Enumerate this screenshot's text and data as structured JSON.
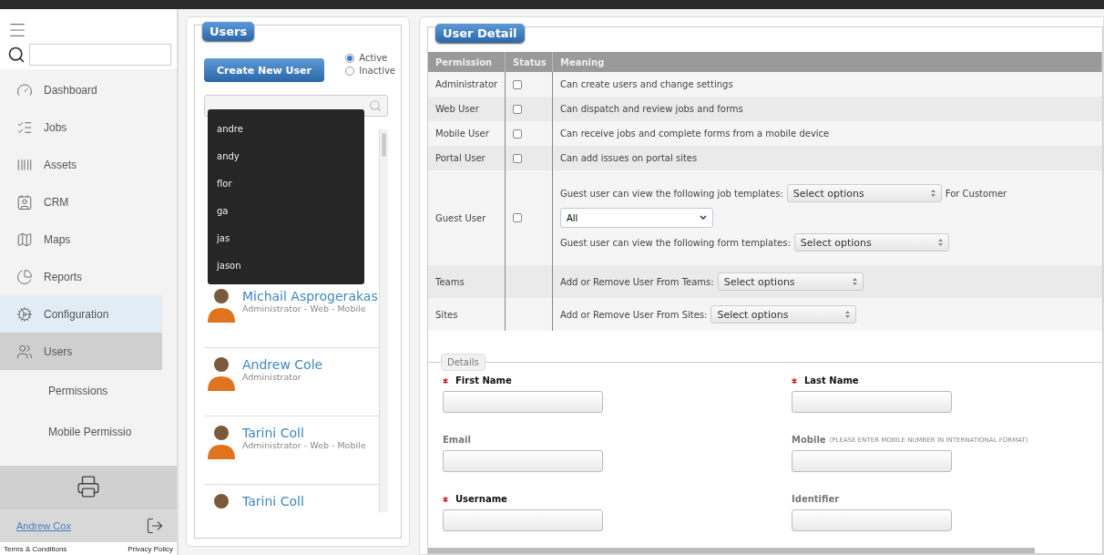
{
  "sidebar": {
    "items": [
      {
        "label": "Dashboard",
        "selected": false,
        "hovered": false
      },
      {
        "label": "Jobs",
        "selected": false,
        "hovered": false
      },
      {
        "label": "Assets",
        "selected": false,
        "hovered": false
      },
      {
        "label": "CRM",
        "selected": false,
        "hovered": false
      },
      {
        "label": "Maps",
        "selected": false,
        "hovered": false
      },
      {
        "label": "Reports",
        "selected": false,
        "hovered": false
      },
      {
        "label": "Configuration",
        "selected": false,
        "hovered": true
      },
      {
        "label": "Users",
        "selected": true,
        "hovered": false,
        "children": [
          {
            "label": "Permissions",
            "selected": false
          },
          {
            "label": "Mobile Permissio",
            "selected": false
          }
        ]
      }
    ],
    "user": "Andrew Cox",
    "footer_links": [
      "Terms & Conditions",
      "Privacy Policy"
    ]
  },
  "users_panel": {
    "title": "Users",
    "create_button": "Create New User",
    "status_filter": [
      {
        "label": "Active",
        "selected": true
      },
      {
        "label": "Inactive",
        "selected": false
      }
    ],
    "suggestions": [
      "andre",
      "andy",
      "flor",
      "ga",
      "jas",
      "jason"
    ],
    "users": [
      {
        "name": "Michail Asprogerakas",
        "roles": "Administrator - Web - Mobile"
      },
      {
        "name": "Andrew Cole",
        "roles": "Administrator"
      },
      {
        "name": "Tarini Coll",
        "roles": "Administrator - Web - Mobile"
      },
      {
        "name": "Tarini Coll"
      }
    ]
  },
  "user_detail": {
    "title": "User Detail",
    "columns": [
      "Permission",
      "Status",
      "Meaning"
    ],
    "permissions": [
      {
        "kind": "text",
        "name": "Administrator",
        "checked": false,
        "meaning": "Can create users and change settings"
      },
      {
        "kind": "text",
        "name": "Web User",
        "checked": false,
        "meaning": "Can dispatch and review jobs and forms"
      },
      {
        "kind": "text",
        "name": "Mobile User",
        "checked": false,
        "meaning": "Can receive jobs and complete forms from a mobile device"
      },
      {
        "kind": "text",
        "name": "Portal User",
        "checked": false,
        "meaning": "Can add issues on portal sites"
      },
      {
        "kind": "guest",
        "name": "Guest User",
        "checked": false,
        "job_label": "Guest user can view the following job templates:",
        "job_select": "Select options",
        "customer_label": "For Customer",
        "customer_value": "All",
        "form_label": "Guest user can view the following form templates:",
        "form_select": "Select options"
      },
      {
        "kind": "select",
        "name": "Teams",
        "label": "Add or Remove User From Teams:",
        "select": "Select options"
      },
      {
        "kind": "select",
        "name": "Sites",
        "label": "Add or Remove User From Sites:",
        "select": "Select options"
      }
    ],
    "details": {
      "legend": "Details",
      "fields": [
        {
          "label": "First Name",
          "required": true
        },
        {
          "label": "Last Name",
          "required": true
        },
        {
          "label": "Email",
          "required": false
        },
        {
          "label": "Mobile",
          "required": false,
          "note": "(PLEASE ENTER MOBILE NUMBER IN INTERNATIONAL FORMAT)"
        },
        {
          "label": "Username",
          "required": true
        },
        {
          "label": "Identifier",
          "required": false
        }
      ]
    }
  }
}
